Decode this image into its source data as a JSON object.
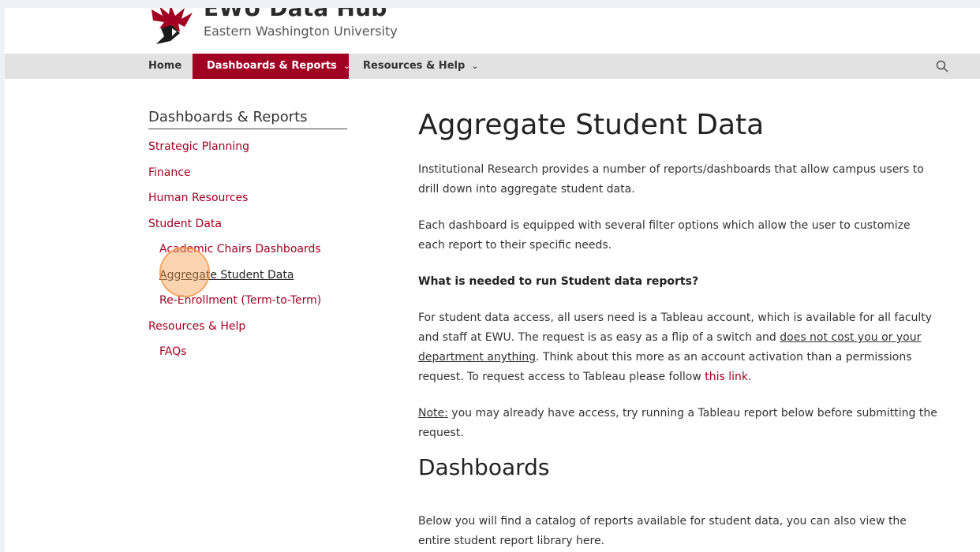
{
  "header": {
    "site_title": "EWU Data Hub",
    "site_subtitle": "Eastern Washington University",
    "logo_icon": "eagle-logo-icon"
  },
  "nav": {
    "home": "Home",
    "dashboards": "Dashboards & Reports",
    "resources": "Resources & Help",
    "chevron": "⌄",
    "search_icon": "search-icon"
  },
  "colors": {
    "brand_red": "#a10022",
    "nav_bg": "#e2e2e2"
  },
  "sidebar": {
    "title": "Dashboards & Reports",
    "items": [
      {
        "label": "Strategic Planning"
      },
      {
        "label": "Finance"
      },
      {
        "label": "Human Resources"
      },
      {
        "label": "Student Data"
      },
      {
        "label": "Academic Chairs Dashboards"
      },
      {
        "label": "Aggregate Student Data"
      },
      {
        "label": "Re-Enrollment (Term-to-Term)"
      },
      {
        "label": "Resources & Help"
      },
      {
        "label": "FAQs"
      }
    ]
  },
  "main": {
    "title": "Aggregate Student Data",
    "p1": "Institutional Research provides a number of reports/dashboards that allow campus users to drill down into aggregate student data.",
    "p2": "Each dashboard is equipped with several filter options which allow the user to customize each report to their specific needs.",
    "p3": "What is needed to run Student data reports?",
    "p4_a": "For student data access, all users need is a Tableau account, which is available for all faculty and staff at EWU. The request is as easy as a flip of a switch and ",
    "p4_u": "does not cost you or your department anything",
    "p4_b": ". Think about this more as an account activation than a permissions request. To request access to Tableau please follow ",
    "p4_link": "this link",
    "p4_end": ".",
    "p5_note": "Note:",
    "p5_rest": " you may already have access, try running a Tableau report below before submitting the request.",
    "h2": "Dashboards",
    "p6": "Below you will find a catalog of reports available for student data, you can also view the entire student report library here."
  }
}
